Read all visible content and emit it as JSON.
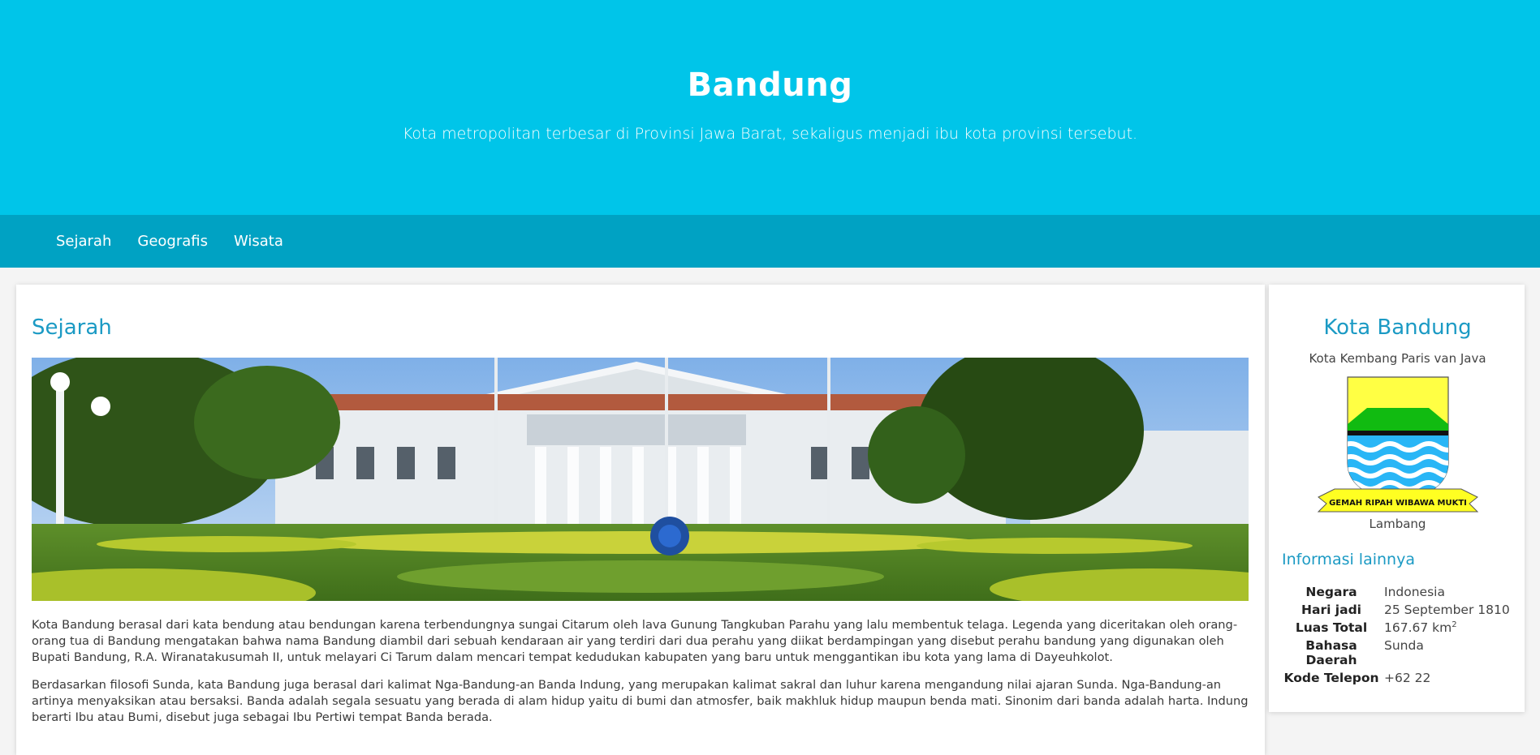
{
  "header": {
    "title": "Bandung",
    "subtitle": "Kota metropolitan terbesar di Provinsi Jawa Barat, sekaligus menjadi ibu kota provinsi tersebut."
  },
  "nav": {
    "items": [
      "Sejarah",
      "Geografis",
      "Wisata"
    ]
  },
  "main": {
    "section_title": "Sejarah",
    "paragraphs": [
      "Kota Bandung berasal dari kata bendung atau bendungan karena terbendungnya sungai Citarum oleh lava Gunung Tangkuban Parahu yang lalu membentuk telaga. Legenda yang diceritakan oleh orang-orang tua di Bandung mengatakan bahwa nama Bandung diambil dari sebuah kendaraan air yang terdiri dari dua perahu yang diikat berdampingan yang disebut perahu bandung yang digunakan oleh Bupati Bandung, R.A. Wiranatakusumah II, untuk melayari Ci Tarum dalam mencari tempat kedudukan kabupaten yang baru untuk menggantikan ibu kota yang lama di Dayeuhkolot.",
      "Berdasarkan filosofi Sunda, kata Bandung juga berasal dari kalimat Nga-Bandung-an Banda Indung, yang merupakan kalimat sakral dan luhur karena mengandung nilai ajaran Sunda. Nga-Bandung-an artinya menyaksikan atau bersaksi. Banda adalah segala sesuatu yang berada di alam hidup yaitu di bumi dan atmosfer, baik makhluk hidup maupun benda mati. Sinonim dari banda adalah harta. Indung berarti Ibu atau Bumi, disebut juga sebagai Ibu Pertiwi tempat Banda berada."
    ]
  },
  "aside": {
    "title": "Kota Bandung",
    "subtitle": "Kota Kembang Paris van Java",
    "emblem_motto": "GEMAH RIPAH WIBAWA MUKTI",
    "emblem_caption": "Lambang",
    "info_title": "Informasi lainnya",
    "info": [
      {
        "key": "Negara",
        "value": "Indonesia"
      },
      {
        "key": "Hari jadi",
        "value": "25 September 1810"
      },
      {
        "key": "Luas Total",
        "value": "167.67 km",
        "sup": "2"
      },
      {
        "key": "Bahasa Daerah",
        "value": "Sunda"
      },
      {
        "key": "Kode Telepon",
        "value": "+62 22"
      }
    ]
  },
  "colors": {
    "header_bg": "#00c5e9",
    "nav_bg": "#00a2c3",
    "accent": "#1b9ac4",
    "emblem_yellow": "#ffff44",
    "emblem_green": "#11bb11",
    "emblem_blue": "#29b6f6"
  }
}
